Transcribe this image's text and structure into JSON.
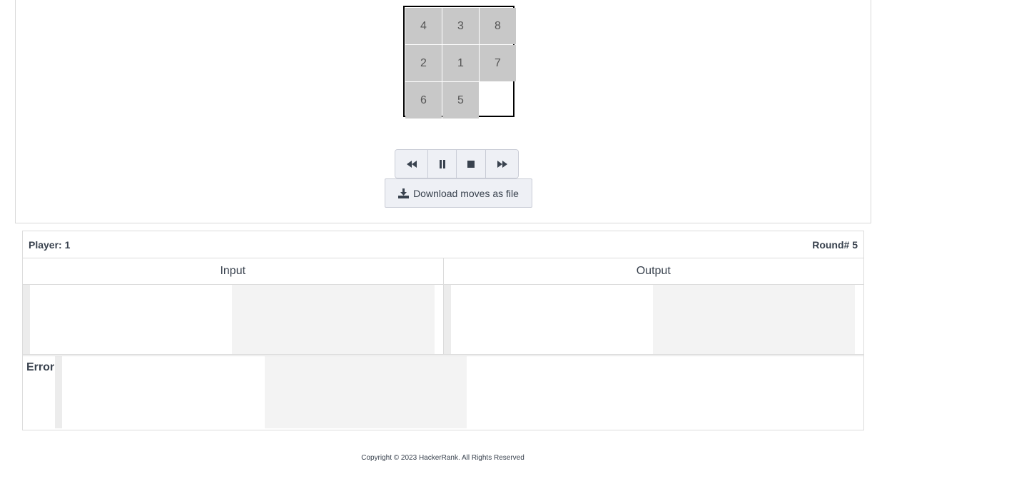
{
  "board": {
    "tiles": [
      "4",
      "3",
      "8",
      "2",
      "1",
      "7",
      "6",
      "5",
      ""
    ]
  },
  "controls": {
    "rewind_icon": "rewind-icon",
    "pause_icon": "pause-icon",
    "stop_icon": "stop-icon",
    "forward_icon": "fast-forward-icon"
  },
  "download": {
    "label": "Download moves as file",
    "icon": "download-icon"
  },
  "result": {
    "player_label": "Player: 1",
    "round_label": "Round# 5",
    "input_header": "Input",
    "output_header": "Output",
    "error_label": "Error"
  },
  "footer": {
    "copyright": "Copyright © 2023 HackerRank. All Rights Reserved"
  }
}
